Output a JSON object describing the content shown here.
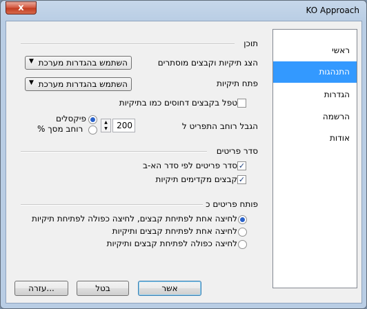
{
  "window": {
    "title": "KO Approach",
    "close_glyph": "x"
  },
  "nav": {
    "items": [
      "ראשי",
      "התנהגות",
      "הגדרות",
      "הרשמה",
      "אודות"
    ],
    "selected": "התנהגות"
  },
  "content": {
    "section": "תוכן",
    "show_hidden_label": "הצג תיקיות וקבצים מוסתרים",
    "show_hidden_value": "השתמש בהגדרות מערכת",
    "open_folders_label": "פתח תיקיות",
    "open_folders_value": "השתמש בהגדרות מערכת",
    "compressed_as_folders_label": "טפל בקבצים דחוסים כמו בתיקיות",
    "compressed_as_folders_checked": false,
    "limit_width_label": "הגבל רוחב התפריט ל",
    "limit_width_value": "200",
    "pixels_label": "פיקסלים",
    "pixels_selected": true,
    "screen_percent_label": "% רוחב מסך",
    "screen_percent_selected": false
  },
  "sort": {
    "section": "סדר פריטים",
    "alphabetical_label": "סדר פריטים לפי סדר הא-ב",
    "alphabetical_checked": true,
    "folders_first_label": "קבצים מקדימים תיקיות",
    "folders_first_checked": true
  },
  "opener": {
    "section": "פותח פריטים כ",
    "options": [
      {
        "label": "לחיצה אחת לפתיחת קבצים, לחיצה כפולה לפתיחת תיקיות",
        "selected": true
      },
      {
        "label": "לחיצה אחת לפתיחת קבצים ותיקיות",
        "selected": false
      },
      {
        "label": "לחיצה כפולה לפתיחת קבצים ותיקיות",
        "selected": false
      }
    ]
  },
  "buttons": {
    "ok": "אשר",
    "cancel": "בטל",
    "help": "עזרה..."
  },
  "colors": {
    "selection": "#3399ff",
    "title_bar": "#b9cde4",
    "close_button": "#c13b20"
  }
}
